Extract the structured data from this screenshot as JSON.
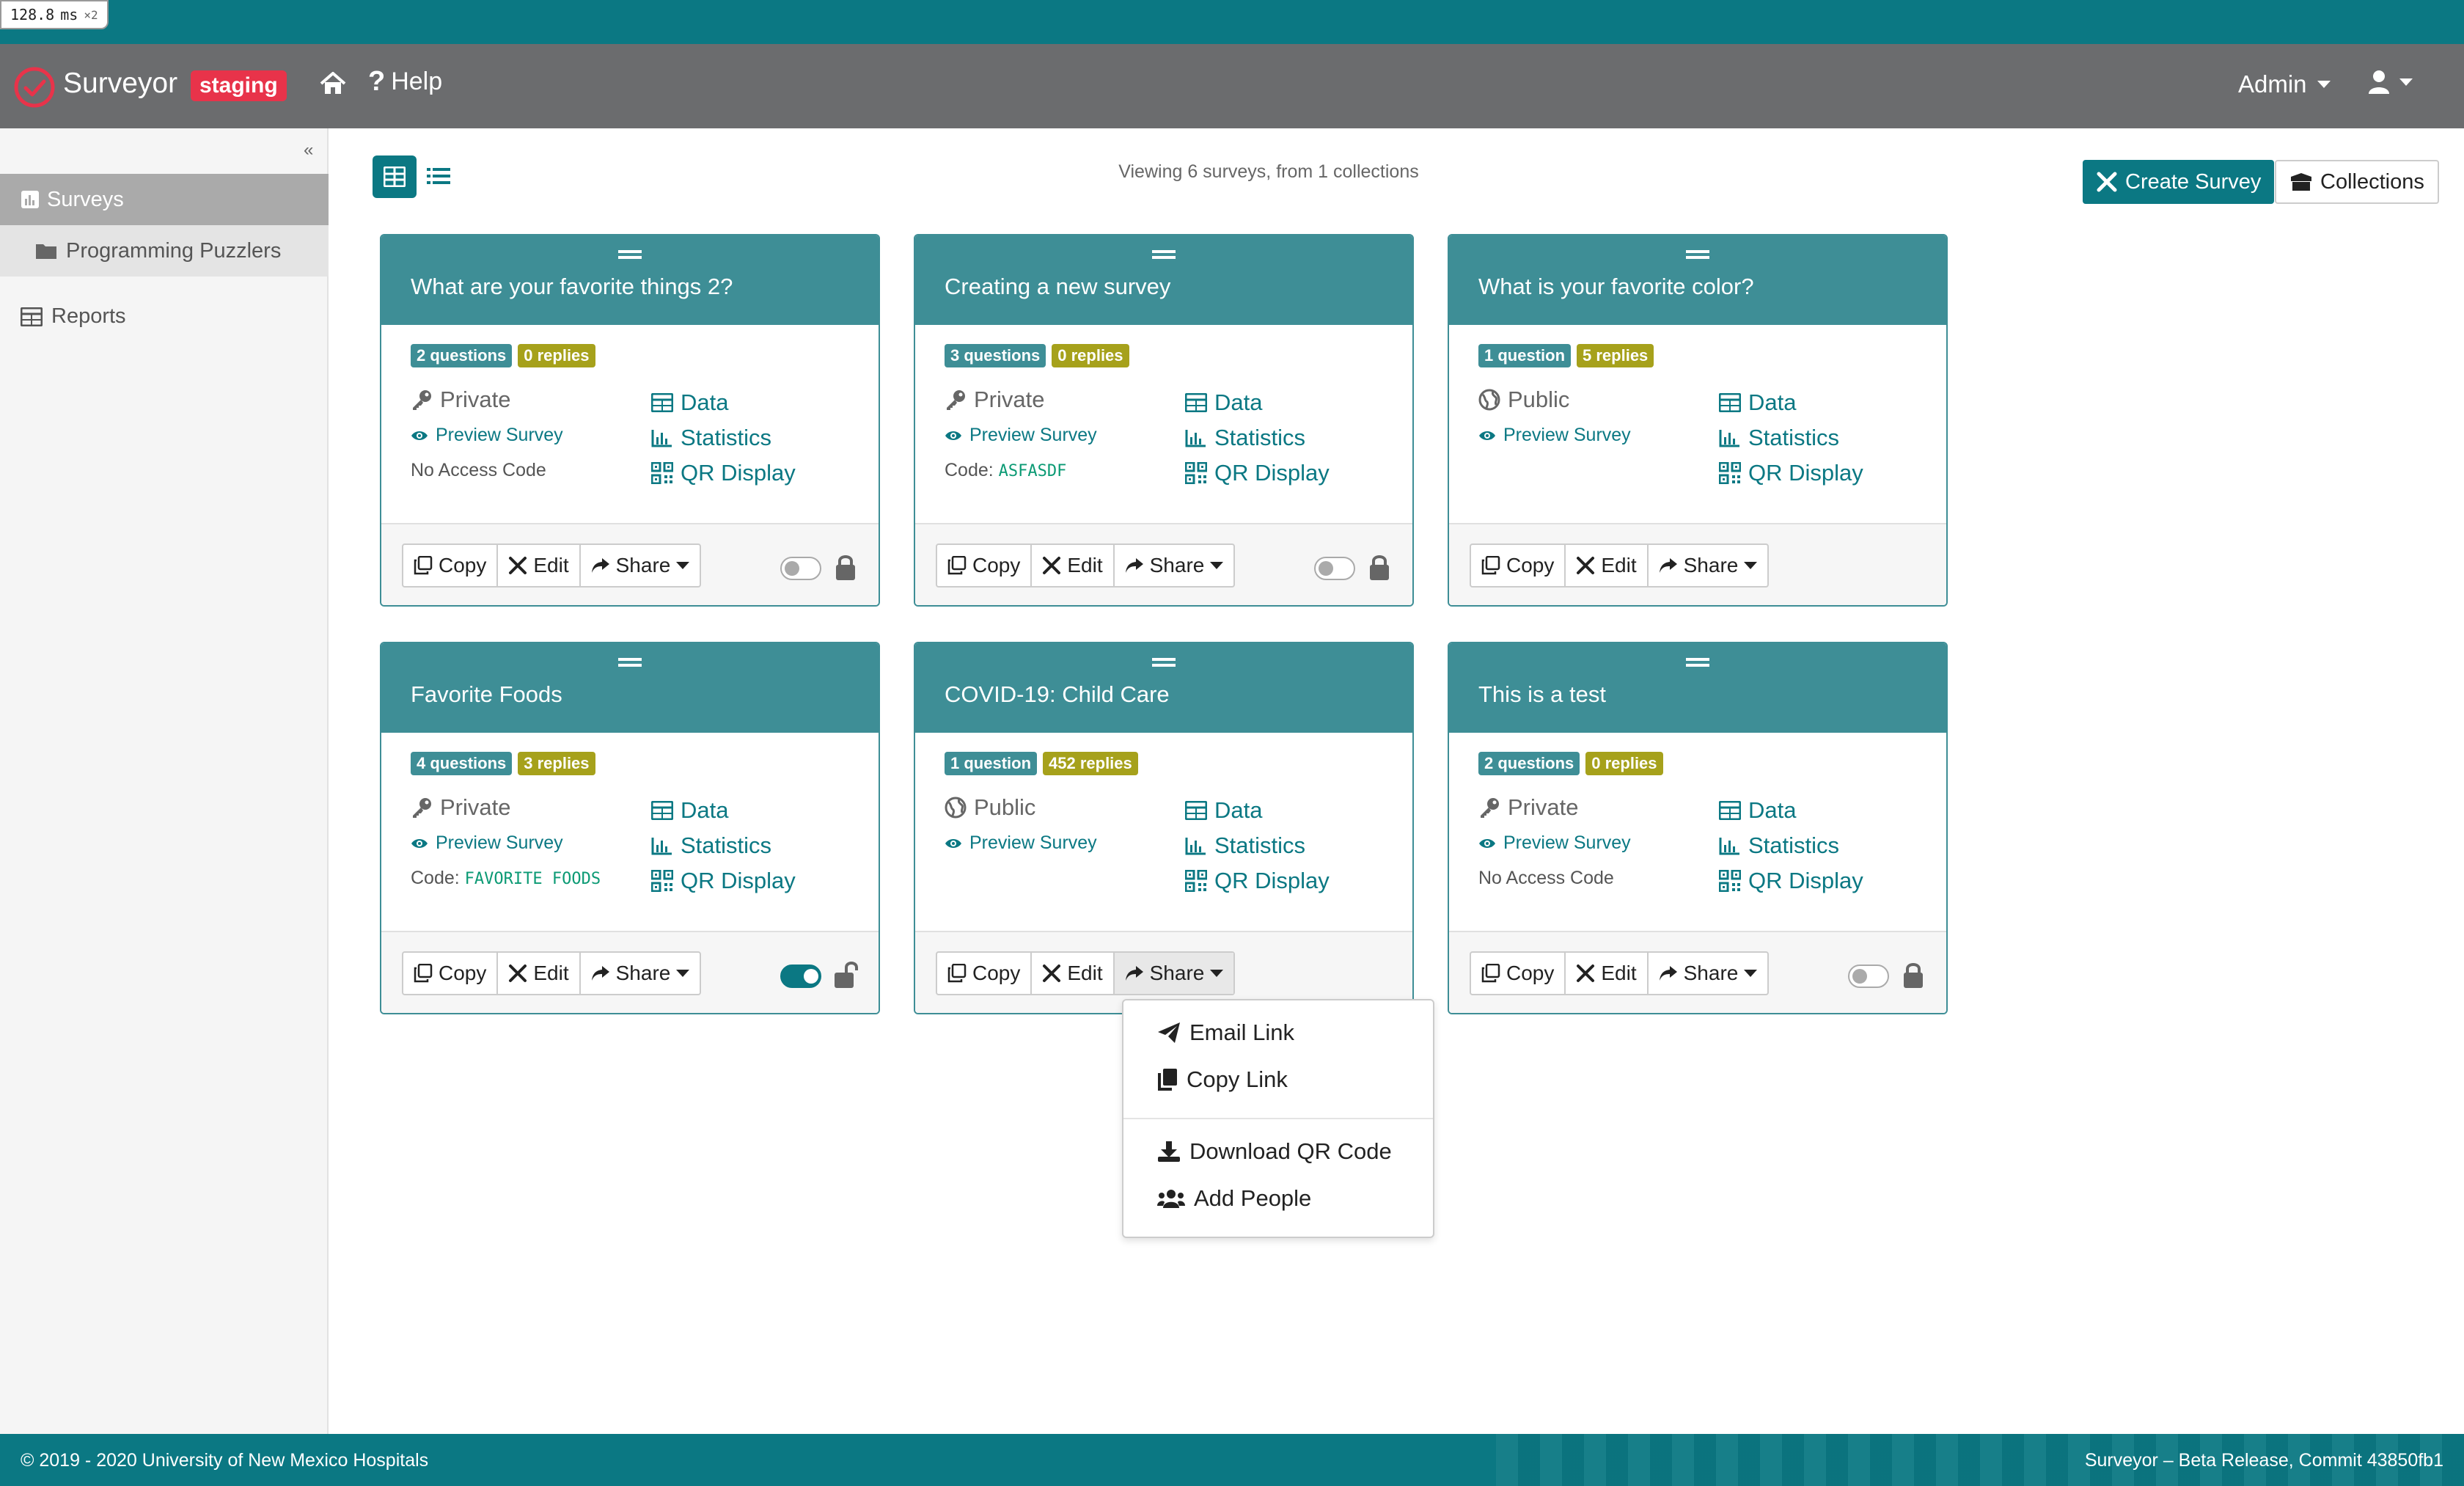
{
  "perf": {
    "value": "128.8",
    "unit": "ms",
    "mult": "×2"
  },
  "navbar": {
    "brand": "Surveyor",
    "env_badge": "staging",
    "help": "Help",
    "help_glyph": "?",
    "admin": "Admin",
    "icons": [
      "check-circle-icon",
      "home-icon",
      "user-icon"
    ]
  },
  "sidebar": {
    "collapse": "«",
    "items": [
      {
        "label": "Surveys",
        "icon": "chart-icon"
      },
      {
        "label": "Programming Puzzlers",
        "icon": "folder-icon"
      },
      {
        "label": "Reports",
        "icon": "table-icon"
      }
    ]
  },
  "toolbar": {
    "viewing": "Viewing 6 surveys, from 1 collections",
    "create": "Create Survey",
    "collections": "Collections"
  },
  "card_labels": {
    "data": "Data",
    "statistics": "Statistics",
    "qr": "QR Display",
    "preview": "Preview Survey",
    "copy": "Copy",
    "edit": "Edit",
    "share": "Share"
  },
  "cards": [
    {
      "title": "What are your favorite things 2?",
      "questions": "2 questions",
      "replies": "0 replies",
      "privacy": "Private",
      "code_label": "No Access Code",
      "code": "",
      "toggle_on": false,
      "locked": true
    },
    {
      "title": "Creating a new survey",
      "questions": "3 questions",
      "replies": "0 replies",
      "privacy": "Private",
      "code_label": "Code:",
      "code": "ASFASDF",
      "toggle_on": false,
      "locked": true
    },
    {
      "title": "What is your favorite color?",
      "questions": "1 question",
      "replies": "5 replies",
      "privacy": "Public",
      "code_label": "",
      "code": "",
      "toggle_on": null,
      "locked": null
    },
    {
      "title": "Favorite Foods",
      "questions": "4 questions",
      "replies": "3 replies",
      "privacy": "Private",
      "code_label": "Code:",
      "code": "FAVORITE FOODS",
      "toggle_on": true,
      "locked": false
    },
    {
      "title": "COVID-19: Child Care",
      "questions": "1 question",
      "replies": "452 replies",
      "privacy": "Public",
      "code_label": "",
      "code": "",
      "toggle_on": null,
      "locked": null
    },
    {
      "title": "This is a test",
      "questions": "2 questions",
      "replies": "0 replies",
      "privacy": "Private",
      "code_label": "No Access Code",
      "code": "",
      "toggle_on": false,
      "locked": true
    }
  ],
  "share_menu": {
    "email": "Email Link",
    "copy": "Copy Link",
    "download_qr": "Download QR Code",
    "add_people": "Add People"
  },
  "footer": {
    "copyright": "© 2019 - 2020 University of New Mexico Hospitals",
    "release": "Surveyor – Beta Release, Commit 43850fb1"
  },
  "colors": {
    "teal": "#0b7883",
    "card_head": "#3e8e96",
    "badge_red": "#e8334a",
    "badge_olive": "#a6a11b",
    "navbar": "#6b6c6e"
  }
}
